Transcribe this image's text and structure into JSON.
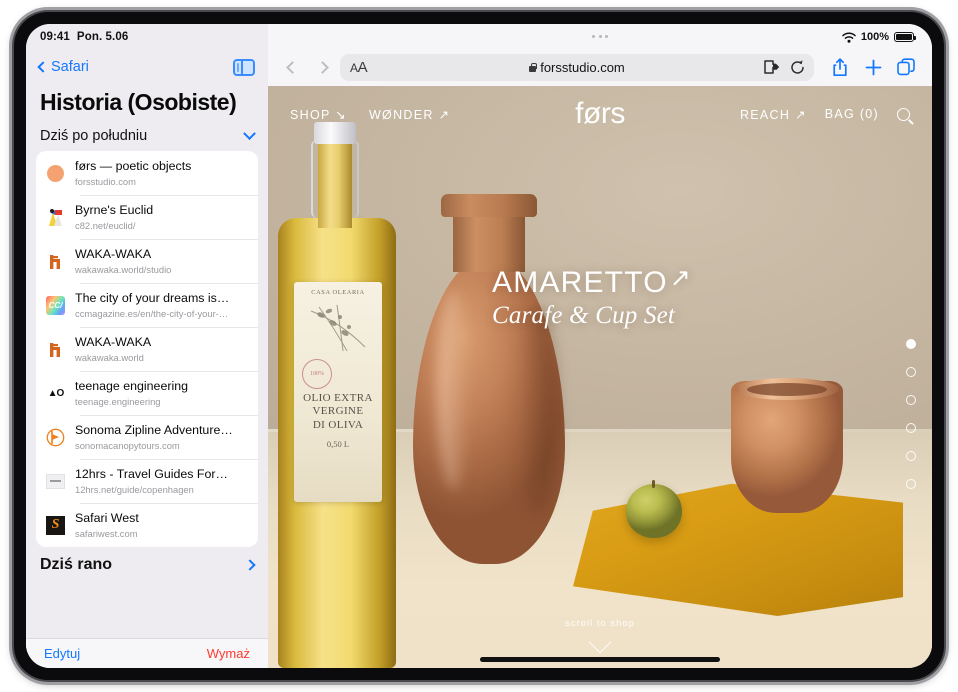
{
  "status": {
    "time": "09:41",
    "date": "Pon. 5.06",
    "battery": "100%",
    "wifi_icon": "wifi-icon",
    "battery_icon": "battery-icon"
  },
  "sidebar": {
    "back_label": "Safari",
    "toggle_icon": "sidebar-toggle-icon",
    "title": "Historia (Osobiste)",
    "group_today_afternoon": "Dziś po południu",
    "group_today_morning": "Dziś rano",
    "items": [
      {
        "title": "førs — poetic objects",
        "url": "forsstudio.com",
        "icon": "circle-favicon"
      },
      {
        "title": "Byrne's Euclid",
        "url": "c82.net/euclid/",
        "icon": "geometry-favicon"
      },
      {
        "title": "WAKA-WAKA",
        "url": "wakawaka.world/studio",
        "icon": "chair-favicon"
      },
      {
        "title": "The city of your dreams is…",
        "url": "ccmagazine.es/en/the-city-of-your-…",
        "icon": "cc-favicon"
      },
      {
        "title": "WAKA-WAKA",
        "url": "wakawaka.world",
        "icon": "chair-favicon"
      },
      {
        "title": "teenage engineering",
        "url": "teenage.engineering",
        "icon": "te-favicon"
      },
      {
        "title": "Sonoma Zipline Adventure…",
        "url": "sonomacanopytours.com",
        "icon": "zipline-favicon"
      },
      {
        "title": "12hrs - Travel Guides For…",
        "url": "12hrs.net/guide/copenhagen",
        "icon": "12hrs-favicon"
      },
      {
        "title": "Safari West",
        "url": "safariwest.com",
        "icon": "safariwest-favicon"
      }
    ],
    "footer": {
      "edit": "Edytuj",
      "clear": "Wymaż"
    }
  },
  "toolbar": {
    "back_icon": "back-arrow-icon",
    "forward_icon": "forward-arrow-icon",
    "text_size_label": "A",
    "text_size_label_big": "A",
    "lock_icon": "lock-icon",
    "url": "forsstudio.com",
    "extensions_icon": "extensions-icon",
    "reload_icon": "reload-icon",
    "share_icon": "share-icon",
    "new_tab_icon": "plus-icon",
    "tabs_icon": "tabs-icon"
  },
  "site": {
    "nav_left": [
      "SHOP ↘",
      "WØNDER ↗"
    ],
    "brand": "førs",
    "nav_right": [
      "REACH ↗",
      "BAG (0)"
    ],
    "search_icon": "search-icon",
    "hero_title": "AMARETTO",
    "hero_arrow": "↗",
    "hero_subtitle": "Carafe & Cup Set",
    "scroll_label": "scroll to shop",
    "scroll_icon": "chevron-down-icon",
    "dots_total": 6,
    "dots_active": 1,
    "bottle_label": {
      "top": "CASA OLEARIA",
      "stamp": "100%",
      "line1": "OLIO EXTRA",
      "line2": "VERGINE",
      "line3": "DI OLIVA",
      "volume": "0,50 L"
    }
  },
  "colors": {
    "accent": "#1478ff",
    "destructive": "#ff3b30",
    "terracotta": "#c4835a",
    "cloth": "#d99c14",
    "wall": "#c3b49f"
  }
}
